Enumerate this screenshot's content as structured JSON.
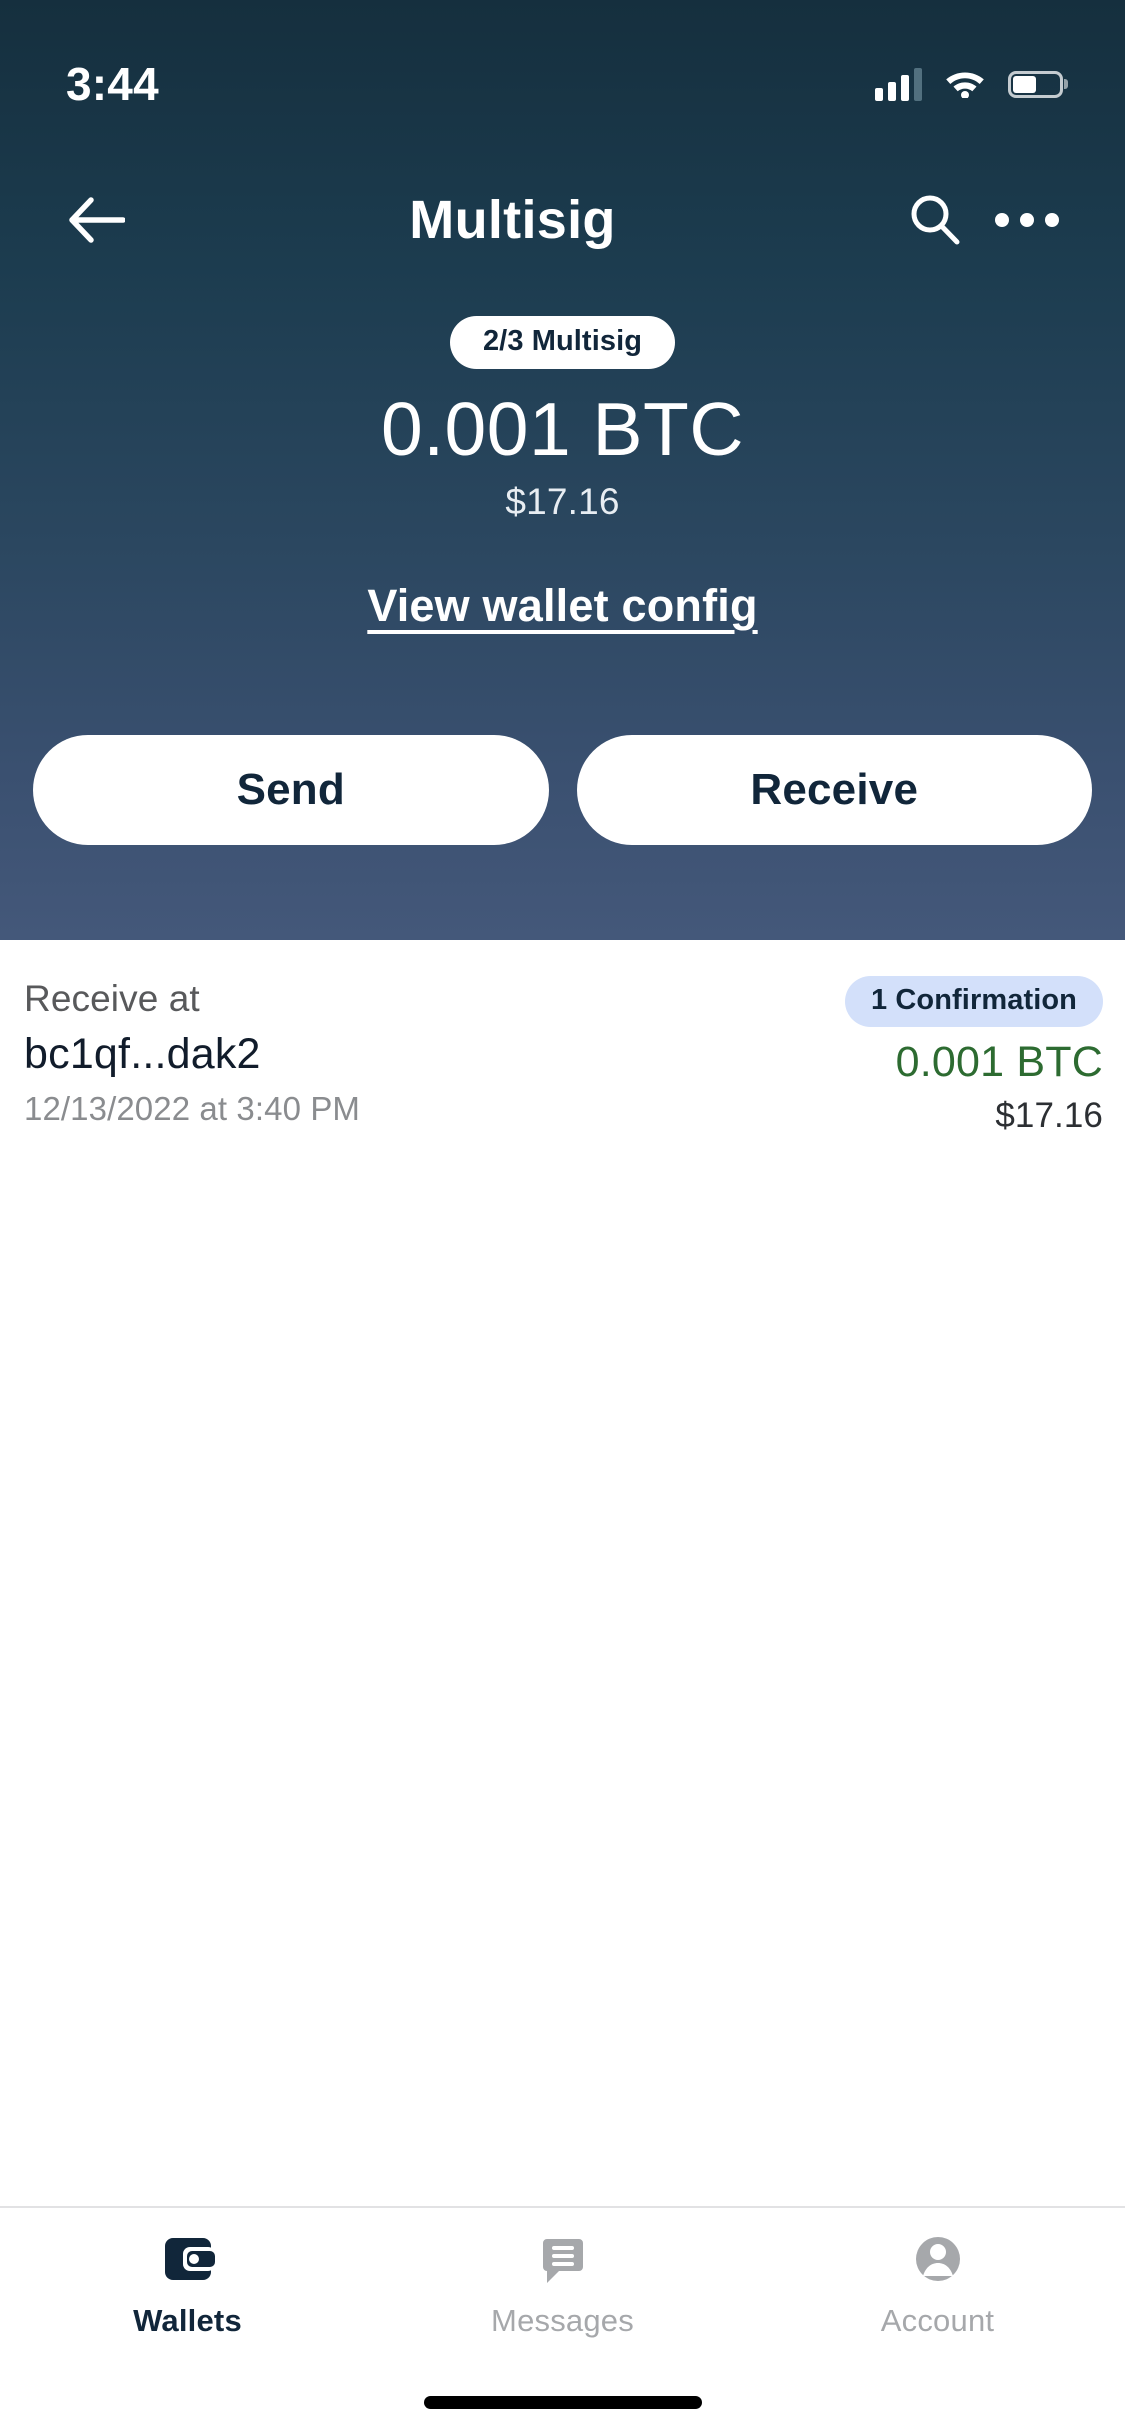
{
  "status_bar": {
    "time": "3:44",
    "icons": [
      "cellular-signal-icon",
      "wifi-icon",
      "battery-icon"
    ],
    "battery_level_pct": 50
  },
  "header": {
    "back_icon": "back-arrow-icon",
    "title": "Multisig",
    "search_icon": "search-icon",
    "menu_icon": "overflow-menu-icon",
    "gradient_top": "#152f3e",
    "gradient_bottom": "#44587a"
  },
  "wallet": {
    "policy_badge": "2/3 Multisig",
    "balance_btc": "0.001 BTC",
    "balance_fiat": "$17.16",
    "config_link": "View wallet config",
    "send_label": "Send",
    "receive_label": "Receive"
  },
  "transactions": [
    {
      "type": "Receive at",
      "address": "bc1qf...dak2",
      "date": "12/13/2022 at 3:40 PM",
      "confirmations": "1 Confirmation",
      "amount_btc": "0.001 BTC",
      "amount_fiat": "$17.16",
      "amount_color": "#2d6b31",
      "badge_bg": "#d3e0fa"
    }
  ],
  "tab_bar": {
    "items": [
      {
        "label": "Wallets",
        "icon": "wallet-icon",
        "active": true
      },
      {
        "label": "Messages",
        "icon": "message-bubble-icon",
        "active": false
      },
      {
        "label": "Account",
        "icon": "account-person-icon",
        "active": false
      }
    ]
  }
}
